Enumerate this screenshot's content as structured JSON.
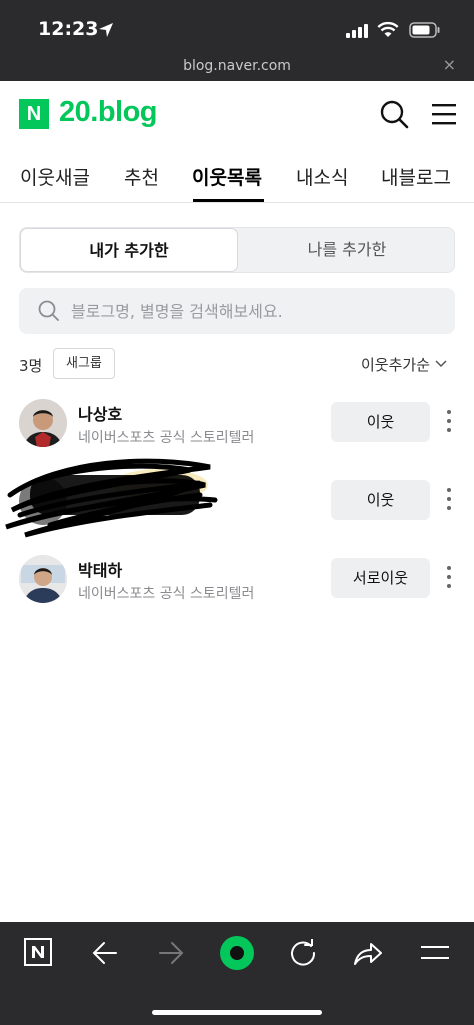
{
  "status_bar": {
    "time": "12:23"
  },
  "url_bar": {
    "domain": "blog.naver.com",
    "close_glyph": "×"
  },
  "header": {
    "logo_letter": "N",
    "logo_text": "20.blog",
    "brand_color": "#03c75a"
  },
  "tabs": [
    {
      "label": "이웃새글",
      "active": false
    },
    {
      "label": "추천",
      "active": false
    },
    {
      "label": "이웃목록",
      "active": true
    },
    {
      "label": "내소식",
      "active": false
    },
    {
      "label": "내블로그",
      "active": false
    }
  ],
  "segment": {
    "added_by_me": "내가 추가한",
    "added_me": "나를 추가한"
  },
  "search": {
    "placeholder": "블로그명, 별명을 검색해보세요.",
    "value": ""
  },
  "list_meta": {
    "count": "3명",
    "new_group": "새그룹",
    "sort": "이웃추가순"
  },
  "neighbors": [
    {
      "name": "나상호",
      "desc": "네이버스포츠 공식 스토리텔러",
      "button": "이웃"
    },
    {
      "name": "",
      "desc": "",
      "button": "이웃",
      "redacted": true
    },
    {
      "name": "박태하",
      "desc": "네이버스포츠 공식 스토리텔러",
      "button": "서로이웃"
    }
  ],
  "icons": {
    "bottom_bar": [
      "naver-home-icon",
      "back-arrow-icon",
      "forward-arrow-icon",
      "green-dot-icon",
      "refresh-icon",
      "share-icon",
      "menu-icon"
    ]
  }
}
